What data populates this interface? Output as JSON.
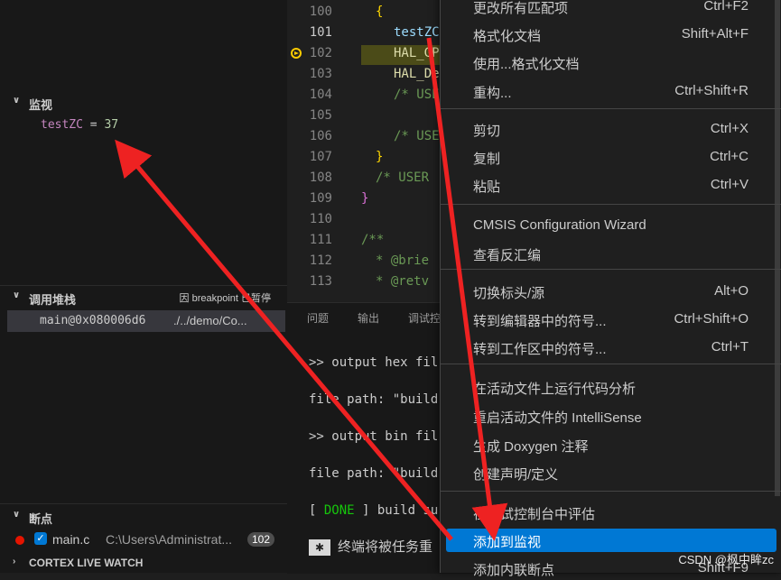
{
  "colors": {
    "accent": "#0078d4",
    "arrow": "#ee2222",
    "breakpoint": "#e51400"
  },
  "sidebar": {
    "watch": {
      "title": "监视",
      "item": {
        "name": "testZC",
        "eq": "=",
        "value": "37"
      }
    },
    "callstack": {
      "title": "调用堆栈",
      "badge": "因 breakpoint 已暂停",
      "frame": {
        "func": "main@0x080006d6",
        "source": "./../demo/Co..."
      }
    },
    "breakpoints": {
      "title": "断点",
      "item": {
        "file": "main.c",
        "path": "C:\\Users\\Administrat...",
        "count": "102"
      }
    },
    "cortex": {
      "title": "CORTEX LIVE WATCH"
    }
  },
  "editor": {
    "lines": [
      {
        "n": "100",
        "t": "{"
      },
      {
        "n": "101",
        "t": "testZC"
      },
      {
        "n": "102",
        "t": "HAL_GP"
      },
      {
        "n": "103",
        "t": "HAL_De"
      },
      {
        "n": "104",
        "t": "/* USE"
      },
      {
        "n": "105",
        "t": ""
      },
      {
        "n": "106",
        "t": "/* USE"
      },
      {
        "n": "107",
        "t": "}"
      },
      {
        "n": "108",
        "t": "/* USER"
      },
      {
        "n": "109",
        "t": "}"
      },
      {
        "n": "110",
        "t": ""
      },
      {
        "n": "111",
        "t": "/**"
      },
      {
        "n": "112",
        "t": "* @brie"
      },
      {
        "n": "113",
        "t": "* @retv"
      }
    ]
  },
  "panel": {
    "tabs": [
      "问题",
      "输出",
      "调试控"
    ],
    "lines": [
      ">> output hex fil",
      "file path: \"build",
      ">> output bin fil",
      "file path: \"build"
    ],
    "done": {
      "prefix": "[ ",
      "status": "DONE",
      "suffix": " ] build su"
    },
    "note": "终端将被任务重"
  },
  "menu": {
    "items": [
      {
        "label": "更改所有匹配项",
        "key": "Ctrl+F2"
      },
      {
        "label": "格式化文档",
        "key": "Shift+Alt+F"
      },
      {
        "label": "使用...格式化文档",
        "key": ""
      },
      {
        "label": "重构...",
        "key": "Ctrl+Shift+R"
      },
      {
        "label": "剪切",
        "key": "Ctrl+X"
      },
      {
        "label": "复制",
        "key": "Ctrl+C"
      },
      {
        "label": "粘贴",
        "key": "Ctrl+V"
      },
      {
        "label": "CMSIS Configuration Wizard",
        "key": ""
      },
      {
        "label": "查看反汇编",
        "key": ""
      },
      {
        "label": "切换标头/源",
        "key": "Alt+O"
      },
      {
        "label": "转到编辑器中的符号...",
        "key": "Ctrl+Shift+O"
      },
      {
        "label": "转到工作区中的符号...",
        "key": "Ctrl+T"
      },
      {
        "label": "在活动文件上运行代码分析",
        "key": ""
      },
      {
        "label": "重启活动文件的 IntelliSense",
        "key": ""
      },
      {
        "label": "生成 Doxygen 注释",
        "key": ""
      },
      {
        "label": "创建声明/定义",
        "key": ""
      },
      {
        "label": "在调试控制台中评估",
        "key": ""
      },
      {
        "label": "添加到监视",
        "key": ""
      },
      {
        "label": "添加内联断点",
        "key": "Shift+F9"
      }
    ]
  },
  "watermark": "CSDN @枫中眸zc"
}
